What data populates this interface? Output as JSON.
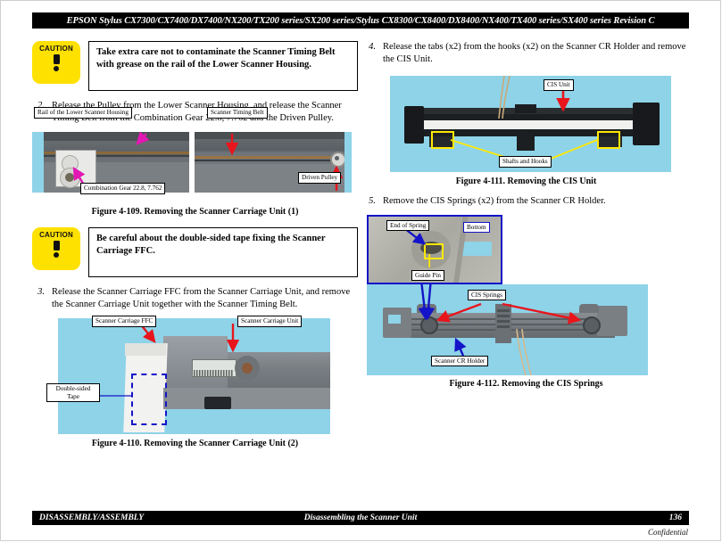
{
  "header": {
    "title": "EPSON Stylus CX7300/CX7400/DX7400/NX200/TX200 series/SX200 series/Stylus CX8300/CX8400/DX8400/NX400/TX400 series/SX400 series   Revision C"
  },
  "footer": {
    "left": "DISASSEMBLY/ASSEMBLY",
    "center": "Disassembling the Scanner Unit",
    "page": "136",
    "confidential": "Confidential"
  },
  "colors": {
    "caution_yellow": "#FFE100",
    "photo_background": "#8ed3e8",
    "arrow_red": "#e8151c",
    "arrow_magenta": "#e318b4",
    "arrow_blue": "#1414c8",
    "highlight_yellow": "#ffe800",
    "header_background": "#000000"
  },
  "left_column": {
    "caution1": {
      "icon_label": "CAUTION",
      "text": "Take extra care not to contaminate the Scanner Timing Belt with grease on the rail of the Lower Scanner Housing."
    },
    "step2": {
      "number": "2.",
      "text": "Release the Pulley from the Lower Scanner Housing, and release the Scanner Timing Belt from the Combination Gear 22.8, 7.762 and the Driven Pulley."
    },
    "figure109": {
      "caption": "Figure 4-109.  Removing the Scanner Carriage Unit (1)",
      "callouts": {
        "rail": "Rail of the Lower Scanner Housing",
        "gear": "Combination Gear 22.8, 7.762",
        "belt": "Scanner Timing Belt",
        "pulley": "Driven Pulley"
      }
    },
    "caution2": {
      "icon_label": "CAUTION",
      "text": "Be careful about the double-sided tape fixing the Scanner Carriage FFC."
    },
    "step3": {
      "number": "3.",
      "text": "Release the Scanner Carriage FFC from the Scanner Carriage Unit, and remove the Scanner Carriage Unit together with the Scanner Timing Belt."
    },
    "figure110": {
      "caption": "Figure 4-110.  Removing the Scanner Carriage Unit (2)",
      "callouts": {
        "ffc": "Scanner Carriage FFC",
        "unit": "Scanner Carriage Unit",
        "tape": "Double-sided Tape"
      }
    }
  },
  "right_column": {
    "step4": {
      "number": "4.",
      "text": "Release the tabs (x2) from the hooks (x2) on the Scanner CR Holder and remove the CIS Unit."
    },
    "figure111": {
      "caption": "Figure 4-111.  Removing the CIS Unit",
      "callouts": {
        "cis_unit": "CIS Unit",
        "shafts_hooks": "Shafts and Hooks"
      }
    },
    "step5": {
      "number": "5.",
      "text": "Remove the CIS Springs (x2) from the Scanner CR Holder."
    },
    "figure112": {
      "caption": "Figure 4-112.  Removing the CIS Springs",
      "callouts": {
        "end_of_spring": "End of Spring",
        "bottom": "Bottom",
        "guide_pin": "Guide Pin",
        "cis_springs": "CIS Springs",
        "cr_holder": "Scanner CR Holder"
      }
    }
  }
}
